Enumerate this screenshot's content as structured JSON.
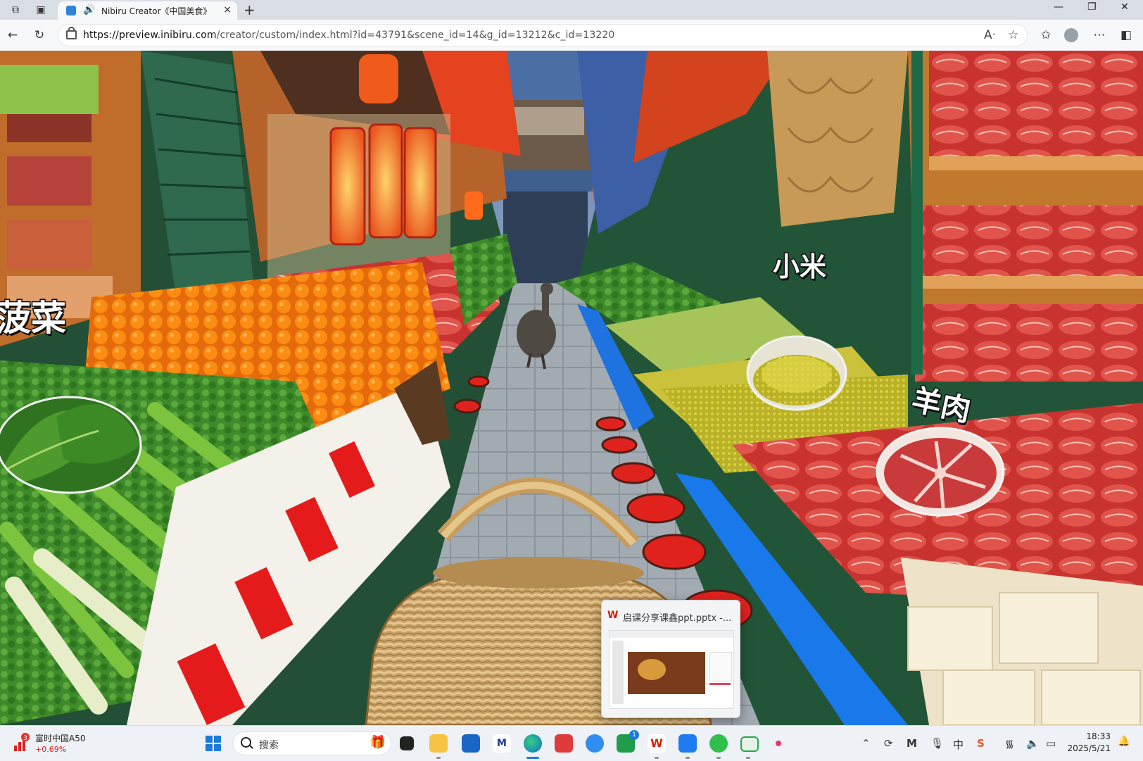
{
  "browser": {
    "tab_title": "Nibiru Creator《中国美食》",
    "tab_close": "×",
    "new_tab": "+",
    "url_domain": "https://preview.inibiru.com",
    "url_path": "/creator/custom/index.html?id=43791&scene_id=14&g_id=13212&c_id=13220",
    "window_controls": [
      "—",
      "❐",
      "✕"
    ],
    "nav_icons": [
      "back-icon",
      "refresh-icon",
      "lock-icon",
      "read-aloud-icon",
      "favorite-star-icon",
      "favorites-icon",
      "profile-icon",
      "more-icon",
      "sidebar-icon"
    ]
  },
  "scene": {
    "labels": {
      "spinach": "菠菜",
      "millet": "小米",
      "lamb": "羊肉"
    }
  },
  "taskbar_preview": {
    "title": "启课分享课鑫ppt.pptx -..."
  },
  "taskbar": {
    "stock_badge": "3",
    "stock_name": "富时中国A50",
    "stock_change": "+0.69%",
    "search_placeholder": "搜索",
    "app_badge": "1",
    "time": "18:33",
    "date": "2025/5/21",
    "colors": {
      "accent": "#1b7cd8",
      "wps": "#d81e06"
    }
  }
}
